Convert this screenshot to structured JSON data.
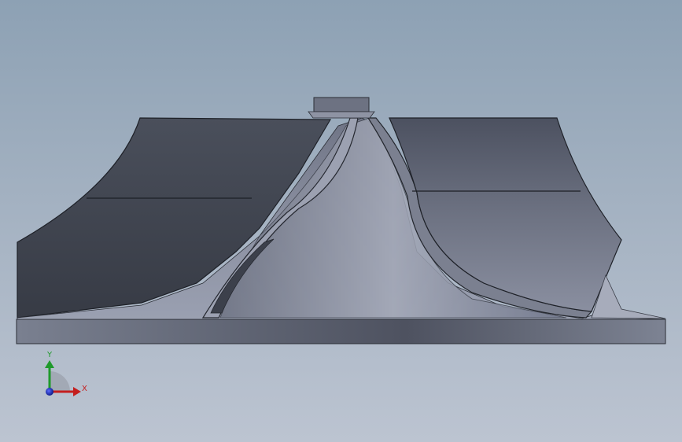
{
  "viewport": {
    "background_top": "#8da1b4",
    "background_bottom": "#bcc4d1"
  },
  "model": {
    "part": "impeller",
    "view": "front"
  },
  "triad": {
    "x_label": "X",
    "y_label": "Y",
    "x_color": "#c41e1e",
    "y_color": "#1f9a2b",
    "z_color": "#1a2fc4"
  }
}
